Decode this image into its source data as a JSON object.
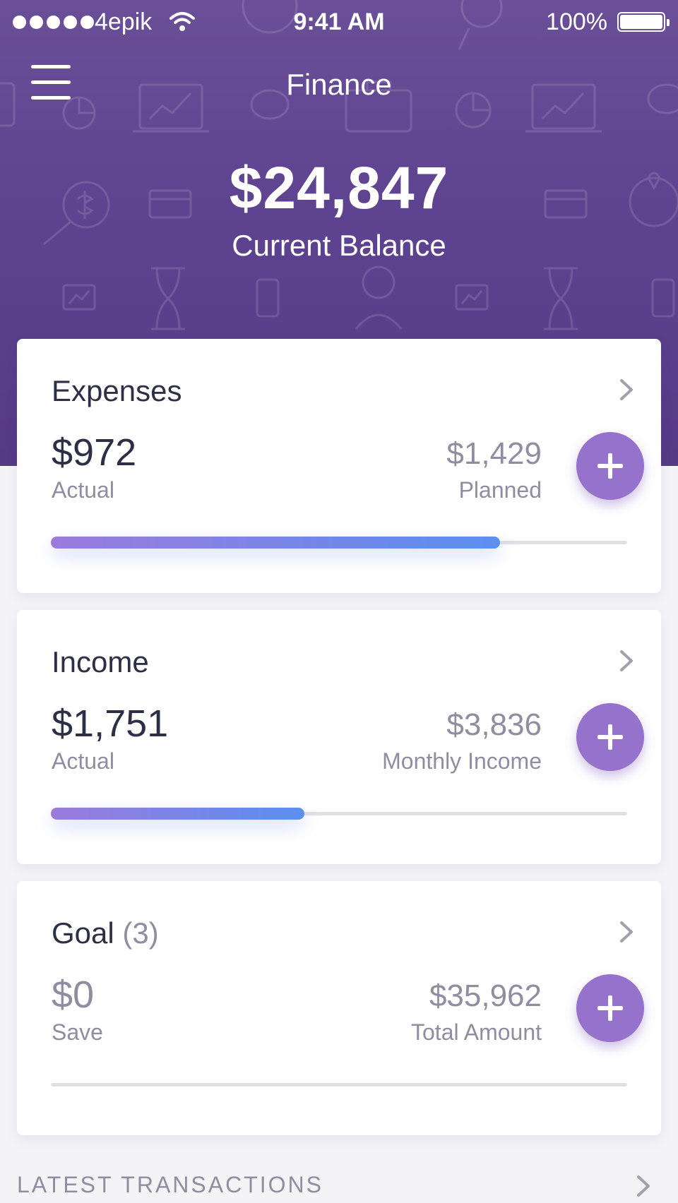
{
  "status_bar": {
    "carrier": "4epik",
    "time": "9:41 AM",
    "battery": "100%"
  },
  "header": {
    "title": "Finance",
    "balance": "$24,847",
    "balance_label": "Current Balance",
    "menu_icon": "hamburger-menu-icon",
    "colors": {
      "top": "#6a4f98",
      "bottom": "#553a86"
    }
  },
  "cards": [
    {
      "title": "Expenses",
      "actual": "$972",
      "actual_label": "Actual",
      "target": "$1,429",
      "target_label": "Planned",
      "progress": 0.78
    },
    {
      "title": "Income",
      "actual": "$1,751",
      "actual_label": "Actual",
      "target": "$3,836",
      "target_label": "Monthly Income",
      "progress": 0.44
    },
    {
      "title": "Goal",
      "count": "(3)",
      "actual": "$0",
      "actual_label": "Save",
      "target": "$35,962",
      "target_label": "Total Amount",
      "progress": 0
    }
  ],
  "latest_transactions": {
    "label": "LATEST TRANSACTIONS"
  },
  "colors": {
    "accent": "#9572cc",
    "progress_start": "#9a7bdc",
    "progress_end": "#5b8ff0",
    "text_dark": "#2c2f45",
    "text_muted": "#8e8ea0"
  }
}
